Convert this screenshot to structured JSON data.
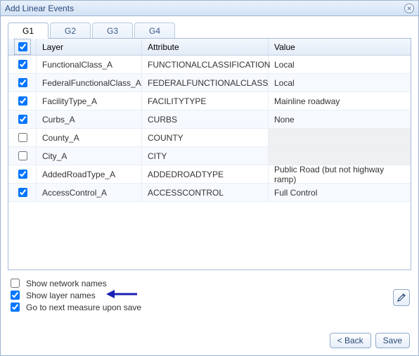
{
  "title": "Add Linear Events",
  "tabs": [
    {
      "label": "G1",
      "active": true
    },
    {
      "label": "G2",
      "active": false
    },
    {
      "label": "G3",
      "active": false
    },
    {
      "label": "G4",
      "active": false
    }
  ],
  "columns": {
    "layer": "Layer",
    "attribute": "Attribute",
    "value": "Value"
  },
  "header_checked": true,
  "rows": [
    {
      "checked": true,
      "layer": "FunctionalClass_A",
      "attribute": "FUNCTIONALCLASSIFICATION",
      "value": "Local"
    },
    {
      "checked": true,
      "layer": "FederalFunctionalClass_A",
      "attribute": "FEDERALFUNCTIONALCLASS",
      "value": "Local"
    },
    {
      "checked": true,
      "layer": "FacilityType_A",
      "attribute": "FACILITYTYPE",
      "value": "Mainline roadway"
    },
    {
      "checked": true,
      "layer": "Curbs_A",
      "attribute": "CURBS",
      "value": "None"
    },
    {
      "checked": false,
      "layer": "County_A",
      "attribute": "COUNTY",
      "value": ""
    },
    {
      "checked": false,
      "layer": "City_A",
      "attribute": "CITY",
      "value": ""
    },
    {
      "checked": true,
      "layer": "AddedRoadType_A",
      "attribute": "ADDEDROADTYPE",
      "value": "Public Road (but not highway ramp)"
    },
    {
      "checked": true,
      "layer": "AccessControl_A",
      "attribute": "ACCESSCONTROL",
      "value": "Full Control"
    }
  ],
  "options": {
    "show_network_names": {
      "label": "Show network names",
      "checked": false
    },
    "show_layer_names": {
      "label": "Show layer names",
      "checked": true
    },
    "go_to_next_measure": {
      "label": "Go to next measure upon save",
      "checked": true
    }
  },
  "buttons": {
    "back": "< Back",
    "save": "Save"
  },
  "edit_icon_name": "pencil-icon"
}
